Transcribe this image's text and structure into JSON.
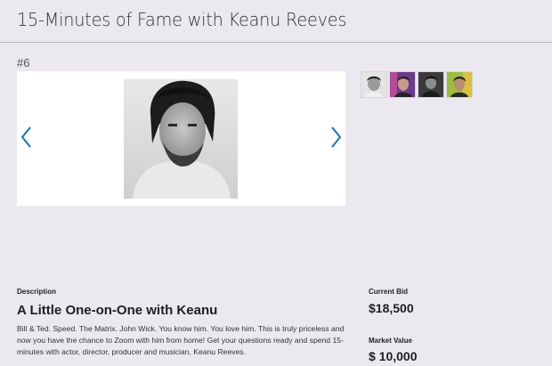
{
  "header": {
    "title": "15-Minutes of Fame with Keanu Reeves"
  },
  "lot": {
    "number": "#6"
  },
  "gallery": {
    "prev_icon": "chevron-left-icon",
    "next_icon": "chevron-right-icon",
    "accent_color": "#1a73c8",
    "thumbnails": [
      {
        "name": "thumbnail-1"
      },
      {
        "name": "thumbnail-2"
      },
      {
        "name": "thumbnail-3"
      },
      {
        "name": "thumbnail-4"
      }
    ]
  },
  "description": {
    "label": "Description",
    "title": "A Little One-on-One with Keanu",
    "text": "Bill & Ted. Speed. The Matrix. John Wick. You know him. You love him. This is truly priceless and now you have the chance to Zoom with him from home! Get your questions ready and spend 15-minutes with actor, director, producer and musician, Keanu Reeves."
  },
  "bidding": {
    "current_bid_label": "Current Bid",
    "current_bid": "$18,500",
    "market_value_label": "Market Value",
    "market_value": "$ 10,000"
  }
}
